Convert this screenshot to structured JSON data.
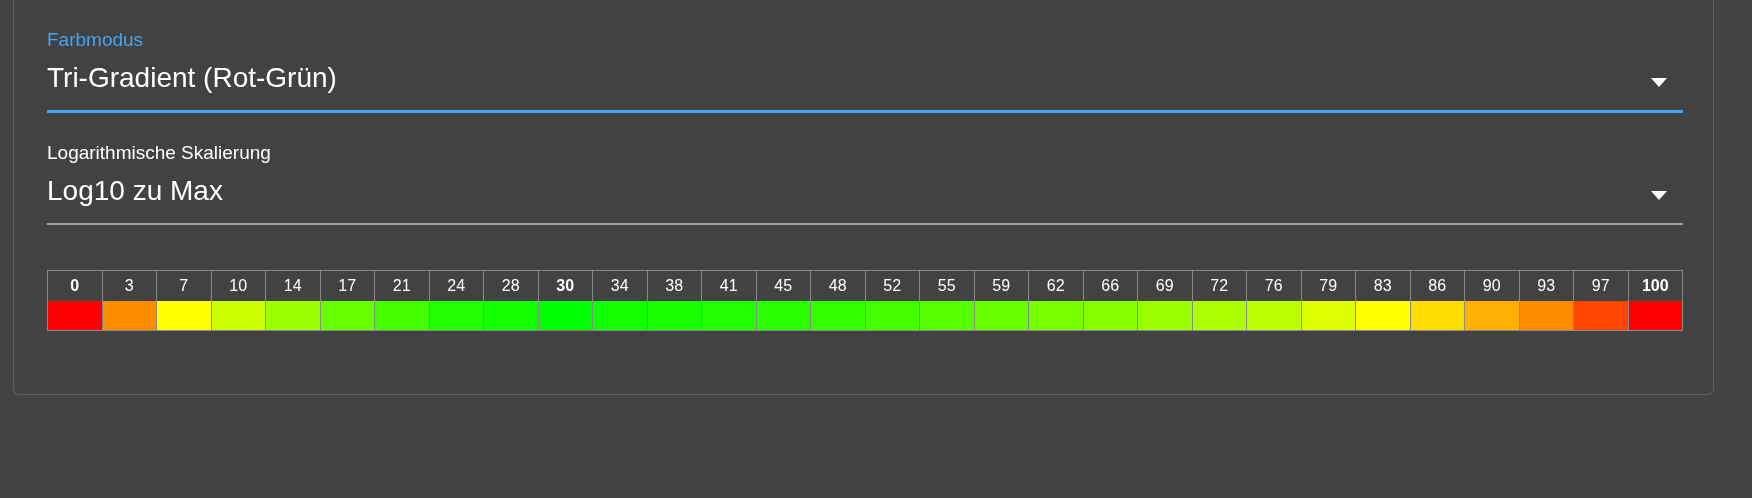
{
  "fields": [
    {
      "label": "Farbmodus",
      "value": "Tri-Gradient (Rot-Grün)",
      "focused": true
    },
    {
      "label": "Logarithmische Skalierung",
      "value": "Log10 zu Max",
      "focused": false
    }
  ],
  "scale": [
    {
      "label": "0",
      "emphasized": true,
      "color": "#ff0000"
    },
    {
      "label": "3",
      "emphasized": false,
      "color": "#ff8c00"
    },
    {
      "label": "7",
      "emphasized": false,
      "color": "#ffff00"
    },
    {
      "label": "10",
      "emphasized": false,
      "color": "#ccff00"
    },
    {
      "label": "14",
      "emphasized": false,
      "color": "#99ff00"
    },
    {
      "label": "17",
      "emphasized": false,
      "color": "#66ff00"
    },
    {
      "label": "21",
      "emphasized": false,
      "color": "#44ff00"
    },
    {
      "label": "24",
      "emphasized": false,
      "color": "#22ff00"
    },
    {
      "label": "28",
      "emphasized": false,
      "color": "#11ff00"
    },
    {
      "label": "30",
      "emphasized": true,
      "color": "#00ff00"
    },
    {
      "label": "34",
      "emphasized": false,
      "color": "#11ff00"
    },
    {
      "label": "38",
      "emphasized": false,
      "color": "#1aff00"
    },
    {
      "label": "41",
      "emphasized": false,
      "color": "#22ff00"
    },
    {
      "label": "45",
      "emphasized": false,
      "color": "#2aff00"
    },
    {
      "label": "48",
      "emphasized": false,
      "color": "#33ff00"
    },
    {
      "label": "52",
      "emphasized": false,
      "color": "#44ff00"
    },
    {
      "label": "55",
      "emphasized": false,
      "color": "#55ff00"
    },
    {
      "label": "59",
      "emphasized": false,
      "color": "#66ff00"
    },
    {
      "label": "62",
      "emphasized": false,
      "color": "#77ff00"
    },
    {
      "label": "66",
      "emphasized": false,
      "color": "#88ff00"
    },
    {
      "label": "69",
      "emphasized": false,
      "color": "#99ff00"
    },
    {
      "label": "72",
      "emphasized": false,
      "color": "#aaff00"
    },
    {
      "label": "76",
      "emphasized": false,
      "color": "#bbff00"
    },
    {
      "label": "79",
      "emphasized": false,
      "color": "#ddff00"
    },
    {
      "label": "83",
      "emphasized": false,
      "color": "#ffff00"
    },
    {
      "label": "86",
      "emphasized": false,
      "color": "#ffdd00"
    },
    {
      "label": "90",
      "emphasized": false,
      "color": "#ffb000"
    },
    {
      "label": "93",
      "emphasized": false,
      "color": "#ff8c00"
    },
    {
      "label": "97",
      "emphasized": false,
      "color": "#ff4500"
    },
    {
      "label": "100",
      "emphasized": true,
      "color": "#ff0000"
    }
  ]
}
